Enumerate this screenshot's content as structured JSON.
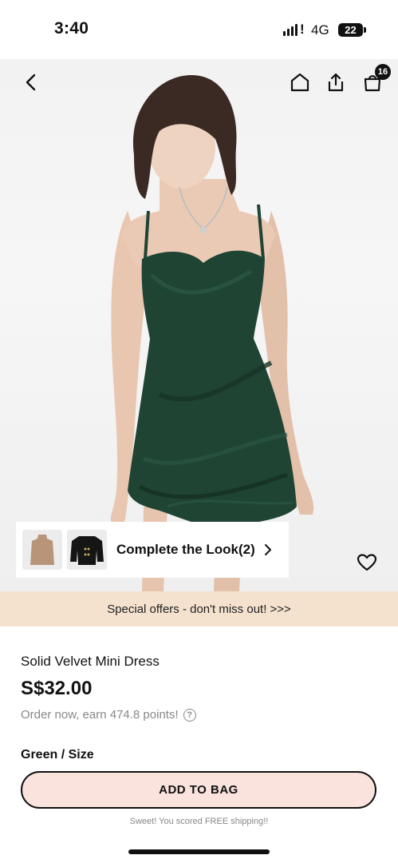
{
  "status_bar": {
    "time": "3:40",
    "network": "4G",
    "battery": "22"
  },
  "nav": {
    "back_icon": "chevron-left-icon",
    "home_icon": "home-icon",
    "share_icon": "share-icon",
    "bag_icon": "shopping-bag-icon",
    "bag_count": "16"
  },
  "look": {
    "label": "Complete the Look(2)",
    "items": [
      "tan-turtleneck-top",
      "black-cropped-jacket"
    ]
  },
  "offers": {
    "text": "Special offers - don't miss out! >>>"
  },
  "product": {
    "name": "Solid Velvet Mini Dress",
    "price": "S$32.00",
    "points": "Order now, earn 474.8 points!",
    "help_icon": "?",
    "color_size_label": "Green / Size"
  },
  "cta": {
    "add_to_bag": "ADD TO BAG",
    "shipping": "Sweet! You scored FREE shipping!!"
  },
  "colors": {
    "offers_bg": "#f4e2cf",
    "button_bg": "#f9e3dc",
    "dress": "#1f4434"
  }
}
